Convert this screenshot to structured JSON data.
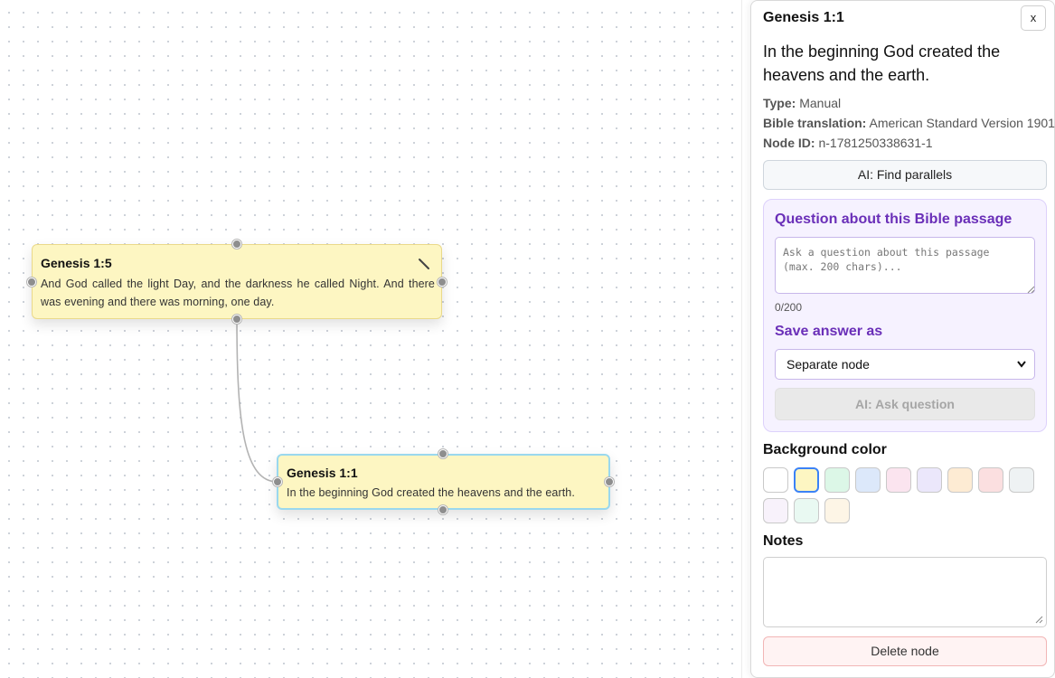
{
  "canvas": {
    "nodes": [
      {
        "title": "Genesis 1:5",
        "text": "And God called the light Day, and the darkness he called Night. And there was evening and there was morning, one day."
      },
      {
        "title": "Genesis 1:1",
        "text": "In the beginning God created the heavens and the earth."
      }
    ]
  },
  "panel": {
    "title": "Genesis 1:1",
    "close_label": "x",
    "verse": "In the beginning God created the heavens and the earth.",
    "meta": {
      "type_label": "Type:",
      "type_value": "Manual",
      "translation_label": "Bible translation:",
      "translation_value": "American Standard Version 1901",
      "node_id_label": "Node ID:",
      "node_id_value": "n-1781250338631-1"
    },
    "find_parallels_label": "AI: Find parallels",
    "question": {
      "heading": "Question about this Bible passage",
      "placeholder": "Ask a question about this passage (max. 200 chars)...",
      "counter": "0/200",
      "save_heading": "Save answer as",
      "save_option": "Separate node",
      "ask_label": "AI: Ask question"
    },
    "background_heading": "Background color",
    "colors": [
      "#ffffff",
      "#fdf6c2",
      "#dcf7e7",
      "#dce8fa",
      "#fbe4ef",
      "#ebe7fb",
      "#fdebd3",
      "#fbdfe0",
      "#eef2f3",
      "#f8f2fb",
      "#e9f9f2",
      "#fdf5e6"
    ],
    "selected_color": "#fdf6c2",
    "notes_heading": "Notes",
    "delete_label": "Delete node"
  }
}
